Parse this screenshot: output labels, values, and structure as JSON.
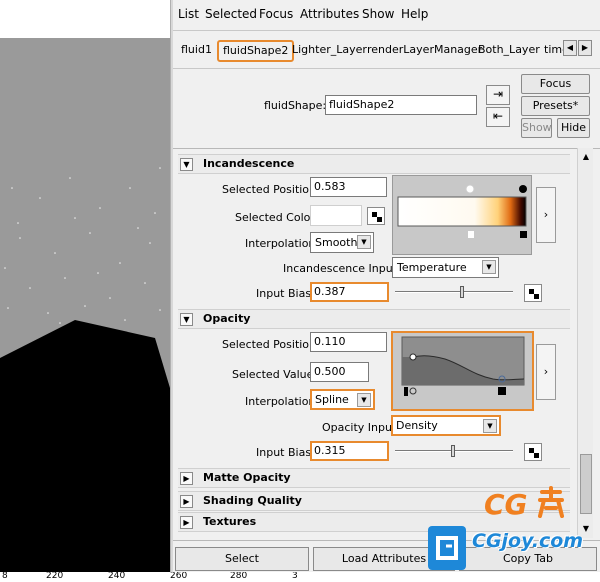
{
  "menu": [
    "List",
    "Selected",
    "Focus",
    "Attributes",
    "Show",
    "Help"
  ],
  "tabs": [
    "fluid1",
    "fluidShape2",
    "Lighter_Layer",
    "renderLayerManager",
    "Both_Layer",
    "time"
  ],
  "node": {
    "label": "fluidShape:",
    "value": "fluidShape2",
    "focus": "Focus",
    "presets": "Presets*",
    "show": "Show",
    "hide": "Hide"
  },
  "incandescence": {
    "title": "Incandescence",
    "selected_position_label": "Selected Position",
    "selected_position": "0.583",
    "selected_color_label": "Selected Color",
    "interpolation_label": "Interpolation",
    "interpolation": "Smooth",
    "input_label": "Incandescence Input",
    "input": "Temperature",
    "input_bias_label": "Input Bias",
    "input_bias": "0.387",
    "input_bias_level": 0.387
  },
  "opacity": {
    "title": "Opacity",
    "selected_position_label": "Selected Position",
    "selected_position": "0.110",
    "selected_value_label": "Selected Value",
    "selected_value": "0.500",
    "interpolation_label": "Interpolation",
    "interpolation": "Spline",
    "input_label": "Opacity Input",
    "input": "Density",
    "input_bias_label": "Input Bias",
    "input_bias": "0.315",
    "input_bias_level": 0.315
  },
  "collapsed_sections": [
    "Matte Opacity",
    "Shading Quality",
    "Textures"
  ],
  "bottom": {
    "select": "Select",
    "load_attributes": "Load Attributes",
    "copy_tab": "Copy Tab"
  },
  "ruler": [
    "8",
    "220",
    "240",
    "260",
    "280",
    "3"
  ],
  "colors": {
    "highlight": "#e88a2e",
    "viewport_gray": "#9a9a9a",
    "ramp_bg": "#c8c8c8"
  },
  "watermark": {
    "brand": "CG",
    "site": "CGjoy.com"
  }
}
